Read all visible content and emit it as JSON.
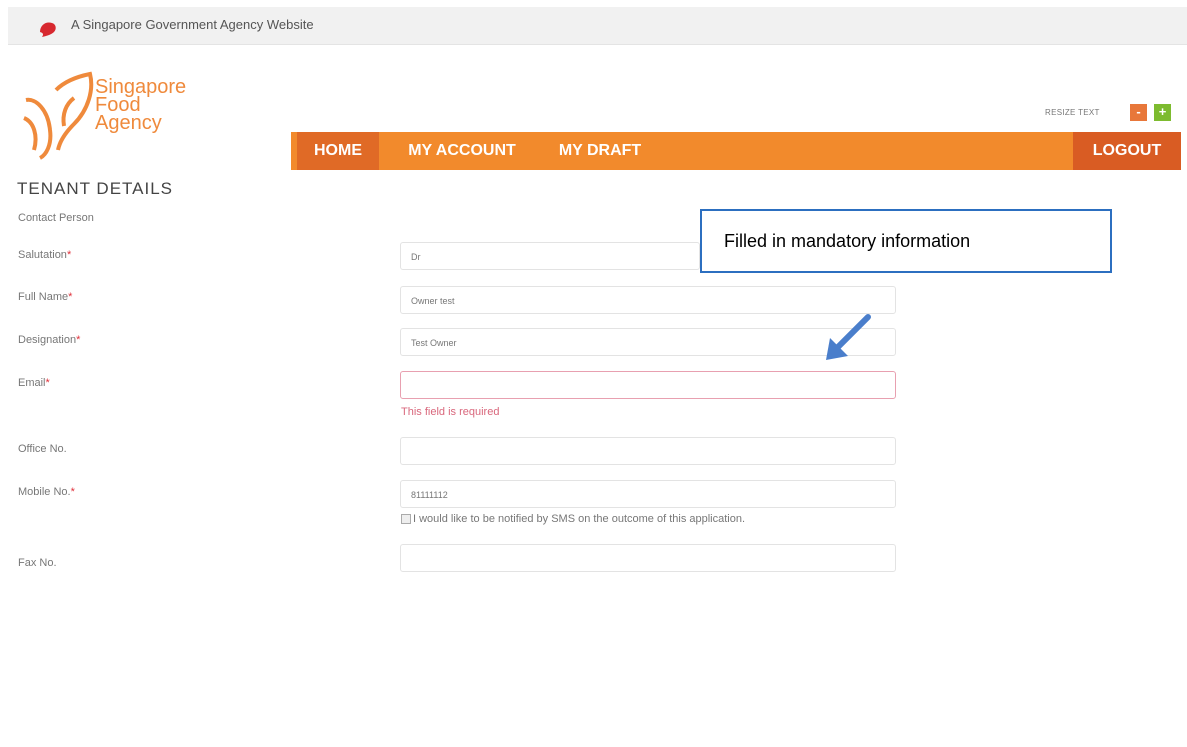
{
  "topbar": {
    "gov_text": "A Singapore Government Agency Website"
  },
  "logo": {
    "line1": "Singapore",
    "line2": "Food",
    "line3": "Agency"
  },
  "resize": {
    "label": "RESIZE TEXT",
    "minus": "-",
    "plus": "+"
  },
  "nav": {
    "home": "HOME",
    "my_account": "MY ACCOUNT",
    "my_draft": "MY DRAFT",
    "logout": "LOGOUT"
  },
  "section": {
    "title": "TENANT DETAILS",
    "subtitle": "Contact Person"
  },
  "form": {
    "salutation": {
      "label": "Salutation",
      "value": "Dr"
    },
    "full_name": {
      "label": "Full Name",
      "value": "Owner test"
    },
    "designation": {
      "label": "Designation",
      "value": "Test Owner"
    },
    "email": {
      "label": "Email",
      "value": "",
      "error": "This field is required"
    },
    "office_no": {
      "label": "Office No.",
      "value": ""
    },
    "mobile_no": {
      "label": "Mobile No.",
      "value": "81111112"
    },
    "sms_notify": {
      "label": "I would like to be notified by SMS on the outcome of this application."
    },
    "fax_no": {
      "label": "Fax No.",
      "value": ""
    },
    "required_mark": "*"
  },
  "annotation": {
    "text": "Filled in mandatory information",
    "border_color": "#2c6fc0"
  },
  "colors": {
    "nav_bg": "#f28a2c",
    "brand_orange": "#ef8a3c",
    "error": "#d9677c"
  }
}
